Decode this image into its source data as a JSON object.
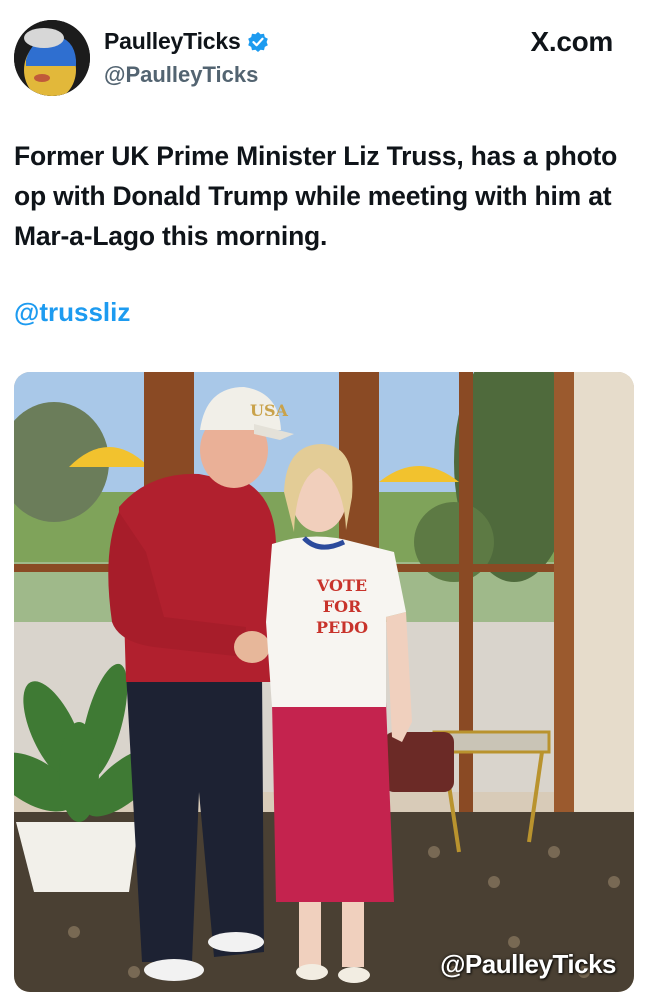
{
  "author": {
    "display_name": "PaulleyTicks",
    "handle": "@PaulleyTicks",
    "verified": true,
    "avatar_icon": "avatar-icon"
  },
  "site_label": "X.com",
  "tweet": {
    "text": "Former UK Prime Minister Liz Truss, has a photo op with Donald Trump while meeting with him at Mar-a-Lago this morning.",
    "mention": "@trussliz"
  },
  "photo": {
    "cap_text": "USA",
    "shirt_text": [
      "VOTE",
      "FOR",
      "PEDO"
    ],
    "watermark": "@PaulleyTicks"
  },
  "colors": {
    "link": "#1d9bf0",
    "verified_badge": "#1d9bf0",
    "text": "#0f1419",
    "secondary_text": "#536471"
  }
}
